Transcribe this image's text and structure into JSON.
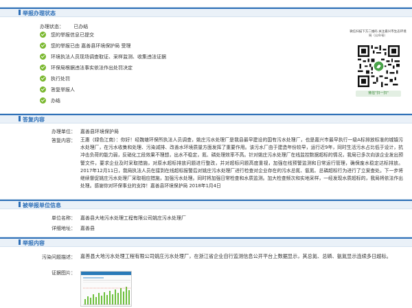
{
  "sections": {
    "status": "举报办理状态",
    "reply": "答复内容",
    "reported": "被举报单位信息",
    "report": "举报内容"
  },
  "status": {
    "label": "办理状态：",
    "value": "已办结"
  },
  "steps": [
    {
      "text": "您的举报信息已提交"
    },
    {
      "text": "您的举报已由 嘉善县环境保护局 受理"
    },
    {
      "text": "环境执法人员现场调查取证、采样监测、收集违法证据"
    },
    {
      "text": "环保局根据违法事实依法作出处罚决定"
    },
    {
      "text": "执行处罚"
    },
    {
      "text": "答复举报人"
    },
    {
      "text": "办结"
    }
  ],
  "qr": {
    "caption": "微信扫描下方二维码 关注嘉兴市生态环境局（公众号）",
    "footer": "微信\"扫一扫\""
  },
  "reply": {
    "unit_label": "办理单位：",
    "unit_value": "嘉善县环境保护局",
    "content_label": "答复内容：",
    "content_value": "王惠（绿色江南）：你好！经魏塘环保所执法人员调查，姚庄污水处理厂是我县最早建设的国有污水处理厂，也是嘉兴市最早执行一级A标排放标准的城镇污水处理厂，在污水收集和处理、污染减排、改善水环境质量方面发挥了重要作用。该污水厂由于建造年份较早，运行近9年，同时生活污水占比低于设计，抗冲击负荷的能力弱，反硝化工段效果不理想，出水不稳定，氮、磷处理效率不高。针对姚庄污水处理厂在线监控数据超标的情况，我局已多次向该企业发出预警文件，要求企业及时采取措施，对原水超标排放问题进行整改，并对超标问题高度重视，加强在线预警监测和日常运行管理，确保废水稳定达标排放。2017年12月11日，我局执法人员在接到在线超标报警后对姚庄污水处理厂进行检查对企业存在的污水总氮、氨氮、总磷超标行为进行了立案查处。下一步将继续督促姚庄污水处理厂采取相应措施，加强污水处理。同时将加强日常检查和水质监测。加大检查频次和实地采样，一经发现水质超标的，我局将依法作出处理。感谢你对环保事业的支持！嘉善县环境保护局 2018年1月4日"
  },
  "reported": {
    "unit_label": "单位名称：",
    "unit_value": "嘉善县大地污水处理工程有限公司姚庄污水处理厂",
    "addr_label": "详细地址：",
    "addr_value": "嘉善县"
  },
  "report": {
    "desc_label": "污染问题描述：",
    "desc_value": "嘉善县大地污水处理工程有限公司姚庄污水处理厂，在浙江省企业自行监测信息公开平台上数据显示，其总氮、总磷、氨氮显示连续多日超标。",
    "photo_label": "证据图片："
  },
  "colors": {
    "accent": "#2d6fb7",
    "check": "#7ab82f",
    "header_bg": "#eaf1f8"
  }
}
